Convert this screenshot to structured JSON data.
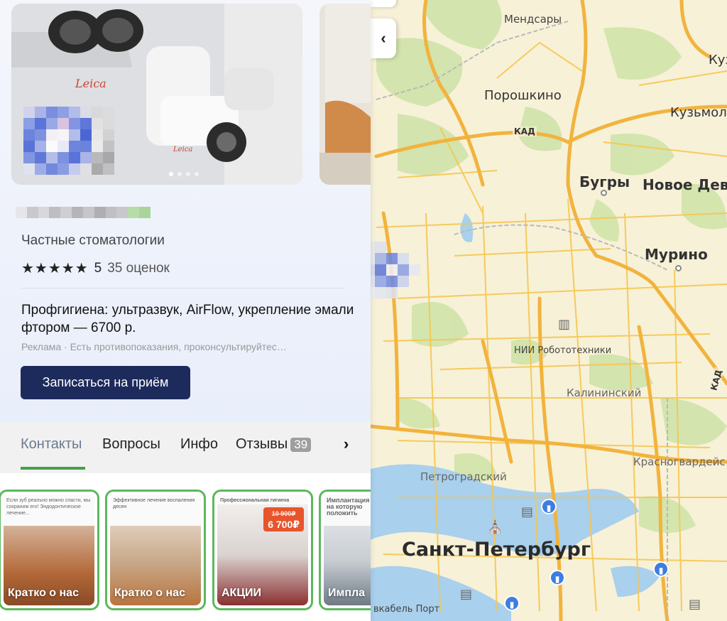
{
  "map": {
    "labels": {
      "mendsary": "Мендсары",
      "poroshkino": "Порошкино",
      "kuz": "Куз",
      "kuzmolovo": "Кузьмол",
      "kad_top": "КАД",
      "kad_right": "КАД",
      "bugry": "Бугры",
      "novoe_devyatkino": "Новое Дев",
      "murino": "Мурино",
      "nii": "НИИ Робототехники",
      "kalininsky": "Калининский",
      "petrogradsky": "Петроградский",
      "krasnogvardeisky": "Красногвардейс",
      "spb": "Санкт-Петербург",
      "port": "вкабель Порт"
    },
    "collapse_icon": "chevron-left-icon",
    "collapse_glyph": "‹"
  },
  "place": {
    "category": "Частные стоматологии",
    "stars": "★★★★★",
    "rating": "5",
    "reviews": "35 оценок",
    "ad_title": "Профгигиена: ультразвук, AirFlow, укрепление эмали фтором — 6700 р.",
    "ad_label": "Реклама",
    "ad_sep": " · ",
    "ad_disclaimer": "Есть противопоказания, проконсультируйтес…",
    "book_button": "Записаться на приём"
  },
  "tabs": {
    "items": [
      "Контакты",
      "Вопросы",
      "Инфо",
      "Отзывы"
    ],
    "reviews_count": "39",
    "next_glyph": "›"
  },
  "stories": [
    {
      "label": "Кратко о нас",
      "caption": "Если зуб реально можно спасти, мы сохраним его! Эндодонтическое лечение..."
    },
    {
      "label": "Кратко о нас",
      "caption": "Эффективное лечение воспаления десен"
    },
    {
      "label": "АКЦИИ",
      "caption": "Профессиональная гигиена",
      "old_price": "10 900₽",
      "new_price": "6 700₽"
    },
    {
      "label": "Импла",
      "caption": "Имплантация на которую положить"
    }
  ],
  "colors": {
    "primary_button": "#1d2b5c",
    "tab_accent": "#43a047",
    "story_border": "#5cb85c",
    "map_road": "#f2b33d",
    "map_water": "#a9d0ec",
    "map_park": "#d4e6b0"
  }
}
